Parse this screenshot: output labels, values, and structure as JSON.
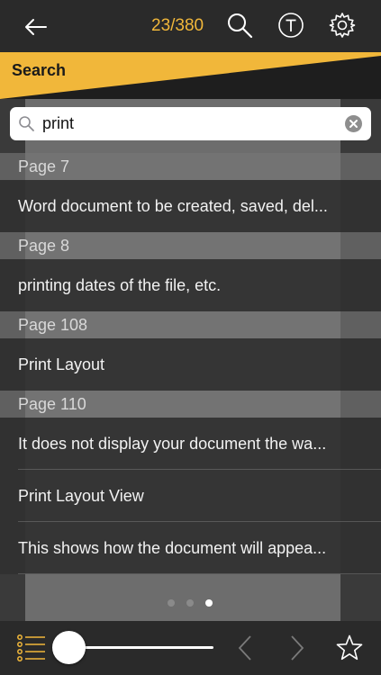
{
  "header": {
    "page_counter": "23/380",
    "icons": [
      "back-arrow-icon",
      "search-icon",
      "text-format-icon",
      "gear-icon"
    ],
    "accent_color": "#f1b73a"
  },
  "search_panel": {
    "title": "Search",
    "query": "print"
  },
  "results": [
    {
      "type": "page",
      "text": "Page 7"
    },
    {
      "type": "result",
      "text": "Word document to be created, saved, del..."
    },
    {
      "type": "page",
      "text": "Page 8"
    },
    {
      "type": "result",
      "text": "printing dates of the file, etc."
    },
    {
      "type": "page",
      "text": "Page 108"
    },
    {
      "type": "result",
      "text": "Print Layout"
    },
    {
      "type": "page",
      "text": "Page 110"
    },
    {
      "type": "result",
      "text": "It does not display your document the wa..."
    },
    {
      "type": "result",
      "text": "Print Layout View"
    },
    {
      "type": "result",
      "text": "This shows how the document will appea..."
    }
  ],
  "pager": {
    "count": 3,
    "active_index": 2
  },
  "bottom_bar": {
    "icons": [
      "toc-list-icon",
      "previous-page-icon",
      "next-page-icon",
      "bookmark-star-icon"
    ],
    "slider_level": 0.03
  }
}
